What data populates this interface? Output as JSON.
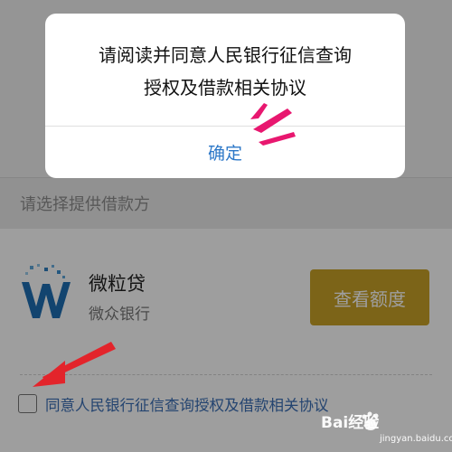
{
  "dialog": {
    "message_line1": "请阅读并同意人民银行征信查询",
    "message_line2": "授权及借款相关协议",
    "confirm_label": "确定"
  },
  "section": {
    "header": "请选择提供借款方"
  },
  "lender": {
    "name": "微粒贷",
    "bank": "微众银行",
    "quota_button": "查看额度",
    "logo_icon": "weilidai-logo-icon"
  },
  "agreement": {
    "checked": false,
    "label": "同意人民银行征信查询授权及借款相关协议"
  },
  "watermark": {
    "brand": "Bai经验",
    "url": "jingyan.baidu.com"
  },
  "colors": {
    "accent_gold": "#c9a227",
    "link_blue": "#2d78c8",
    "annotation_pink": "#e8176f",
    "arrow_red": "#e3242b"
  }
}
